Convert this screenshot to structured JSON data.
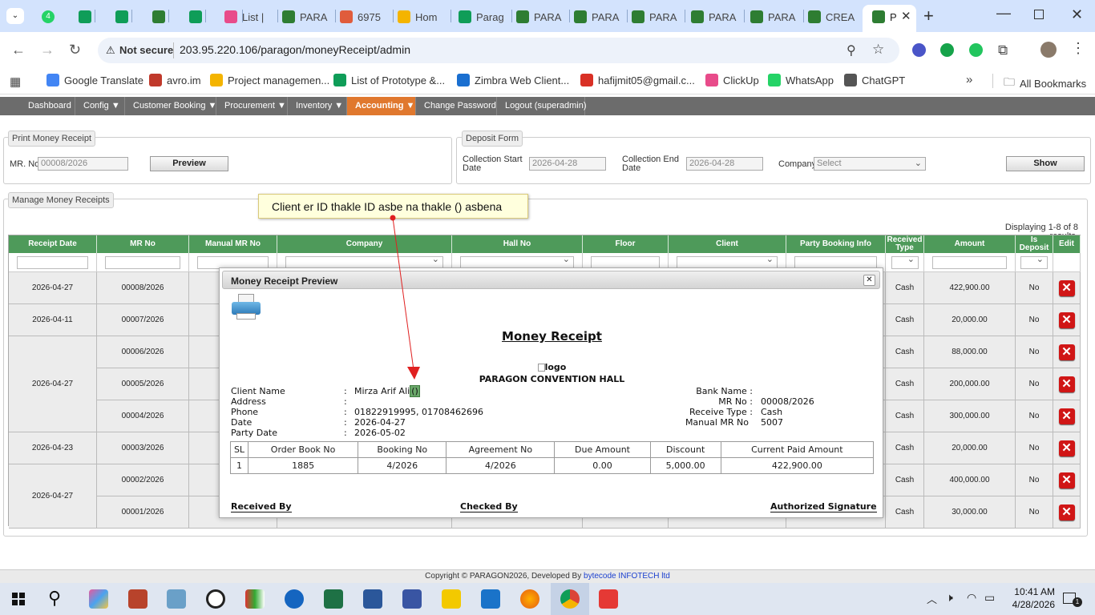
{
  "browser": {
    "tabs": [
      {
        "label": "",
        "icon": "whatsapp-icon"
      },
      {
        "label": "",
        "icon": "sheets-icon"
      },
      {
        "label": "",
        "icon": "sheets-icon"
      },
      {
        "label": "",
        "icon": "app-icon"
      },
      {
        "label": "",
        "icon": "sheets-icon"
      },
      {
        "label": "List |",
        "icon": "clickup-icon"
      },
      {
        "label": "PARA",
        "icon": "app-icon"
      },
      {
        "label": "6975",
        "icon": "puzzle-icon"
      },
      {
        "label": "Hom",
        "icon": "drive-icon"
      },
      {
        "label": "Parag",
        "icon": "sheets-icon"
      },
      {
        "label": "PARA",
        "icon": "app-icon"
      },
      {
        "label": "PARA",
        "icon": "app-icon"
      },
      {
        "label": "PARA",
        "icon": "app-icon"
      },
      {
        "label": "PARA",
        "icon": "app-icon"
      },
      {
        "label": "PARA",
        "icon": "app-icon"
      },
      {
        "label": "CREA",
        "icon": "app-icon"
      }
    ],
    "active_tab_label": "P",
    "security_label": "Not secure",
    "url": "203.95.220.106/paragon/moneyReceipt/admin",
    "bookmarks": [
      {
        "label": "Google Translate"
      },
      {
        "label": "avro.im"
      },
      {
        "label": "Project managemen..."
      },
      {
        "label": "List of Prototype &..."
      },
      {
        "label": "Zimbra Web Client..."
      },
      {
        "label": "hafijmit05@gmail.c..."
      },
      {
        "label": "ClickUp"
      },
      {
        "label": "WhatsApp"
      },
      {
        "label": "ChatGPT"
      }
    ],
    "all_bookmarks": "All Bookmarks",
    "whatsapp_badge": "4"
  },
  "menu": {
    "items": [
      "Dashboard",
      "Config ▼",
      "Customer Booking ▼",
      "Procurement ▼",
      "Inventory ▼",
      "Accounting ▼",
      "Change Password",
      "Logout (superadmin)"
    ]
  },
  "print_section": {
    "legend": "Print Money Receipt",
    "mr_label": "MR. No",
    "mr_value": "00008/2026",
    "preview_button": "Preview"
  },
  "deposit_section": {
    "legend": "Deposit Form",
    "start_label_1": "Collection Start",
    "start_label_2": "Date",
    "start_value": "2026-04-28",
    "end_label_1": "Collection End",
    "end_label_2": "Date",
    "end_value": "2026-04-28",
    "company_label": "Company",
    "company_value": "Select",
    "show_button": "Show"
  },
  "manage": {
    "legend": "Manage Money Receipts",
    "results": "Displaying 1-8 of 8 results.",
    "headers": [
      "Receipt Date",
      "MR No",
      "Manual MR No",
      "Company",
      "Hall No",
      "Floor",
      "Client",
      "Party Booking Info",
      "Received Type",
      "Amount",
      "Is Deposit",
      "Edit"
    ],
    "date_groups": [
      {
        "date": "2026-04-27"
      },
      {
        "date": "2026-04-11"
      },
      {
        "date": "2026-04-27"
      },
      {
        "date": "2026-04-23"
      },
      {
        "date": "2026-04-27"
      }
    ],
    "rows": [
      {
        "mr_no": "00008/2026",
        "type": "Cash",
        "amount": "422,900.00",
        "deposit": "No"
      },
      {
        "mr_no": "00007/2026",
        "type": "Cash",
        "amount": "20,000.00",
        "deposit": "No"
      },
      {
        "mr_no": "00006/2026",
        "type": "Cash",
        "amount": "88,000.00",
        "deposit": "No"
      },
      {
        "mr_no": "00005/2026",
        "type": "Cash",
        "amount": "200,000.00",
        "deposit": "No"
      },
      {
        "mr_no": "00004/2026",
        "type": "Cash",
        "amount": "300,000.00",
        "deposit": "No"
      },
      {
        "mr_no": "00003/2026",
        "type": "Cash",
        "amount": "20,000.00",
        "deposit": "No"
      },
      {
        "mr_no": "00002/2026",
        "type": "Cash",
        "amount": "400,000.00",
        "deposit": "No"
      },
      {
        "mr_no": "00001/2026",
        "type": "Cash",
        "amount": "30,000.00",
        "deposit": "No"
      }
    ]
  },
  "modal": {
    "title": "Money Receipt Preview",
    "receipt_title": "Money Receipt",
    "logo_alt": "logo",
    "hall_name": "PARAGON CONVENTION HALL",
    "client_name_label": "Client Name",
    "client_name": "Mirza Arif Ali",
    "client_id": "()",
    "address_label": "Address",
    "address": "",
    "phone_label": "Phone",
    "phone": "01822919995, 01708462696",
    "date_label": "Date",
    "date": "2026-04-27",
    "party_date_label": "Party Date",
    "party_date": "2026-05-02",
    "bank_label": "Bank Name :",
    "bank": "",
    "mr_label": "MR No :",
    "mr": "00008/2026",
    "receive_type_label": "Receive Type :",
    "receive_type": "Cash",
    "manual_mr_label": "Manual MR No",
    "manual_mr": "5007",
    "table_headers": [
      "SL",
      "Order Book No",
      "Booking No",
      "Agreement No",
      "Due Amount",
      "Discount",
      "Current Paid Amount"
    ],
    "table_row": [
      "1",
      "1885",
      "4/2026",
      "4/2026",
      "0.00",
      "5,000.00",
      "422,900.00"
    ],
    "received_by": "Received By",
    "checked_by": "Checked By",
    "authorized": "Authorized Signature"
  },
  "callout": {
    "text": "Client  er ID thakle ID asbe na thakle () asbena"
  },
  "footer": {
    "text": "Copyright © PARAGON2026, Developed By ",
    "link": "bytecode INFOTECH ltd"
  },
  "taskbar": {
    "time": "10:41 AM",
    "date": "4/28/2026",
    "notification_count": "1"
  },
  "colors": {
    "grid_header": "#4e9a5a",
    "menu_active": "#e0782e",
    "delete": "#d01616",
    "annotation_arrow": "#e02020"
  }
}
